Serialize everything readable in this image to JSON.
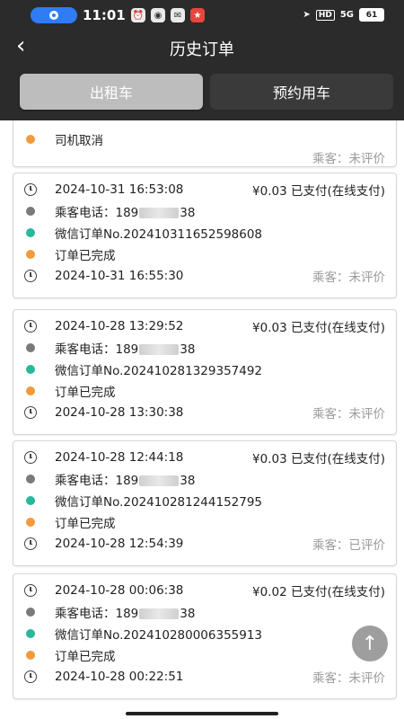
{
  "status": {
    "time": "11:01",
    "battery": "61",
    "network": "5G",
    "hd": "HD"
  },
  "header": {
    "title": "历史订单",
    "back_icon": "chevron-left-icon"
  },
  "tabs": [
    {
      "label": "出租车",
      "active": true
    },
    {
      "label": "预约用车",
      "active": false
    }
  ],
  "partial_card": {
    "status": "司机取消",
    "evaluation": "乘客：未评价"
  },
  "orders": [
    {
      "start_time": "2024-10-31 16:53:08",
      "price": "¥0.03 已支付(在线支付)",
      "phone_prefix": "乘客电话：189",
      "phone_suffix": "38",
      "order_no": "微信订单No.202410311652598608",
      "status": "订单已完成",
      "end_time": "2024-10-31 16:55:30",
      "evaluation": "乘客：未评价"
    },
    {
      "start_time": "2024-10-28 13:29:52",
      "price": "¥0.03 已支付(在线支付)",
      "phone_prefix": "乘客电话：189",
      "phone_suffix": "38",
      "order_no": "微信订单No.202410281329357492",
      "status": "订单已完成",
      "end_time": "2024-10-28 13:30:38",
      "evaluation": "乘客：未评价"
    },
    {
      "start_time": "2024-10-28 12:44:18",
      "price": "¥0.03 已支付(在线支付)",
      "phone_prefix": "乘客电话：189",
      "phone_suffix": "38",
      "order_no": "微信订单No.202410281244152795",
      "status": "订单已完成",
      "end_time": "2024-10-28 12:54:39",
      "evaluation": "乘客：已评价"
    },
    {
      "start_time": "2024-10-28 00:06:38",
      "price": "¥0.02 已支付(在线支付)",
      "phone_prefix": "乘客电话：189",
      "phone_suffix": "38",
      "order_no": "微信订单No.202410280006355913",
      "status": "订单已完成",
      "end_time": "2024-10-28 00:22:51",
      "evaluation": "乘客：未评价"
    }
  ],
  "scroll_top_icon": "arrow-up-icon",
  "scroll_top_glyph": "↑"
}
